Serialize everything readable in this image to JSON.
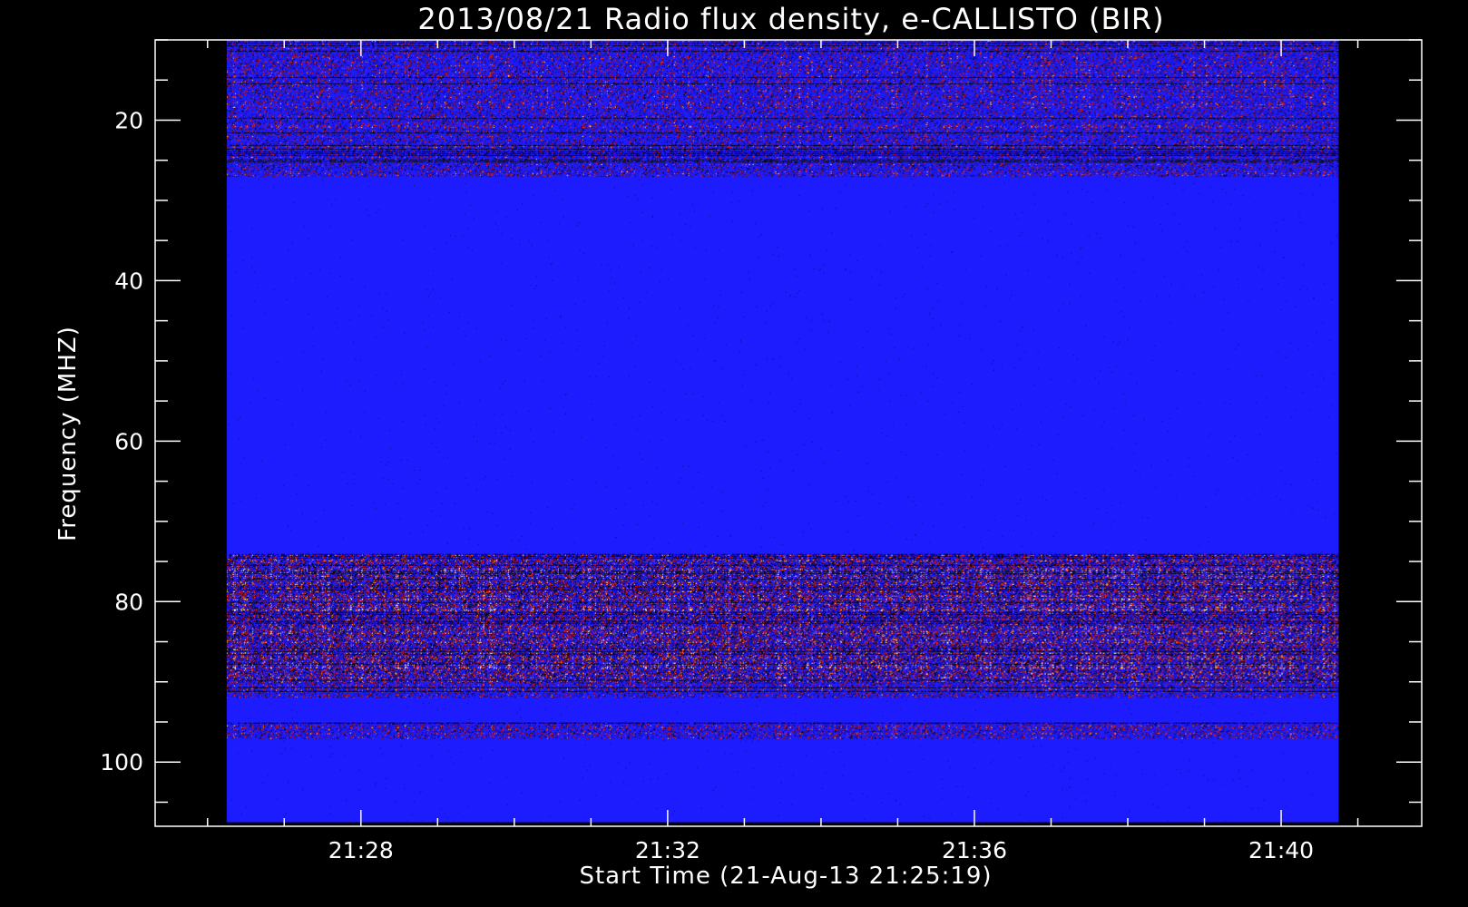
{
  "chart_data": {
    "type": "heatmap",
    "title": "2013/08/21  Radio flux density, e-CALLISTO (BIR)",
    "xlabel": "Start Time (21-Aug-13 21:25:19)",
    "ylabel": "Frequency (MHZ)",
    "x_unit": "time (UT, HH:MM)",
    "xlim": [
      "21:25:19",
      "21:41:50"
    ],
    "x_data_range": [
      "21:26:15",
      "21:40:45"
    ],
    "x_ticks": [
      "21:28",
      "21:32",
      "21:36",
      "21:40"
    ],
    "x_minor_tick_interval_min": 1,
    "ylim": [
      10,
      108
    ],
    "y_data_range": [
      10,
      107.5
    ],
    "y_ticks": [
      20,
      40,
      60,
      80,
      100
    ],
    "y_minor_tick_interval": 5,
    "y_inverted": true,
    "colormap": [
      "#000000",
      "#0a0a8c",
      "#1a1aff",
      "#8c0a0a",
      "#ff2a00",
      "#ffa500",
      "#ffffcc"
    ],
    "grid": false,
    "legend": "none",
    "colors": {
      "background": "#000000",
      "axis": "#ffffff",
      "dominant": "#1a1aff"
    },
    "emission_bands_mhz": [
      {
        "from": 10,
        "to": 27,
        "intensity": "medium"
      },
      {
        "from": 74,
        "to": 90,
        "intensity": "high"
      },
      {
        "from": 90,
        "to": 92,
        "intensity": "medium"
      },
      {
        "from": 95,
        "to": 97,
        "intensity": "medium"
      }
    ]
  }
}
